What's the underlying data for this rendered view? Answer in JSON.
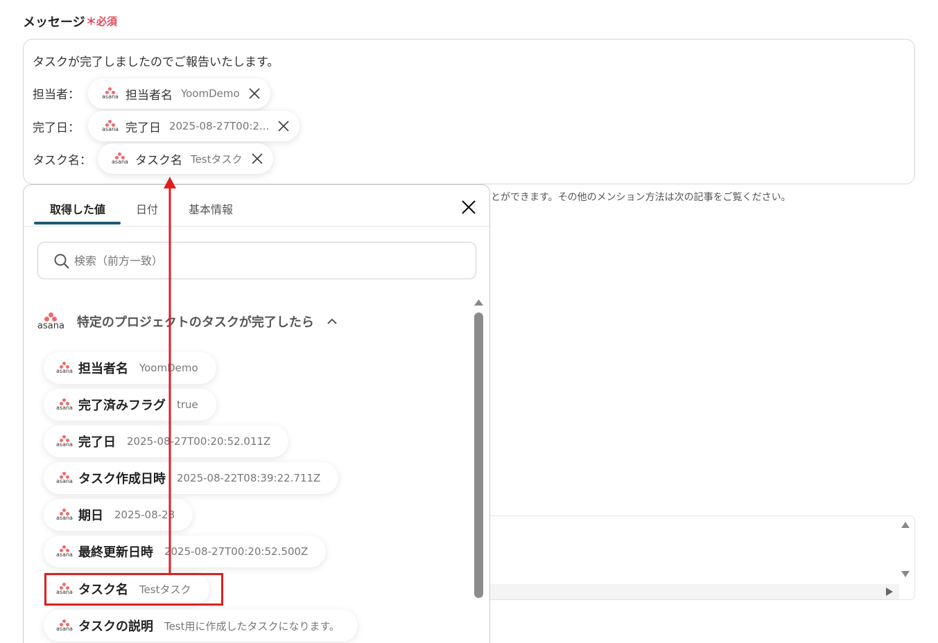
{
  "form": {
    "label": "メッセージ",
    "required": "＊必須",
    "message_line1": "タスクが完了しましたのでご報告いたします。",
    "rows": [
      {
        "label": "担当者：",
        "token_name": "担当者名",
        "token_value": "YoomDemo"
      },
      {
        "label": "完了日：",
        "token_name": "完了日",
        "token_value": "2025-08-27T00:2..."
      },
      {
        "label": "タスク名：",
        "token_name": "タスク名",
        "token_value": "Testタスク"
      }
    ],
    "help_text": "とができます。その他のメンション方法は次の記事をご覧ください。"
  },
  "popup": {
    "tabs": [
      "取得した値",
      "日付",
      "基本情報"
    ],
    "active_tab": "取得した値",
    "search_placeholder": "検索（前方一致）",
    "section_title": "特定のプロジェクトのタスクが完了したら",
    "items": [
      {
        "name": "担当者名",
        "value": "YoomDemo"
      },
      {
        "name": "完了済みフラグ",
        "value": "true"
      },
      {
        "name": "完了日",
        "value": "2025-08-27T00:20:52.011Z"
      },
      {
        "name": "タスク作成日時",
        "value": "2025-08-22T08:39:22.711Z"
      },
      {
        "name": "期日",
        "value": "2025-08-28"
      },
      {
        "name": "最終更新日時",
        "value": "2025-08-27T00:20:52.500Z"
      },
      {
        "name": "タスク名",
        "value": "Testタスク"
      },
      {
        "name": "タスクの説明",
        "value": "Test用に作成したタスクになります。"
      }
    ]
  },
  "logo_word": "asana",
  "colors": {
    "accent": "#1d5a74",
    "asana": "#f06a6a",
    "annotation": "#e01e1e",
    "required": "#e8465a"
  }
}
